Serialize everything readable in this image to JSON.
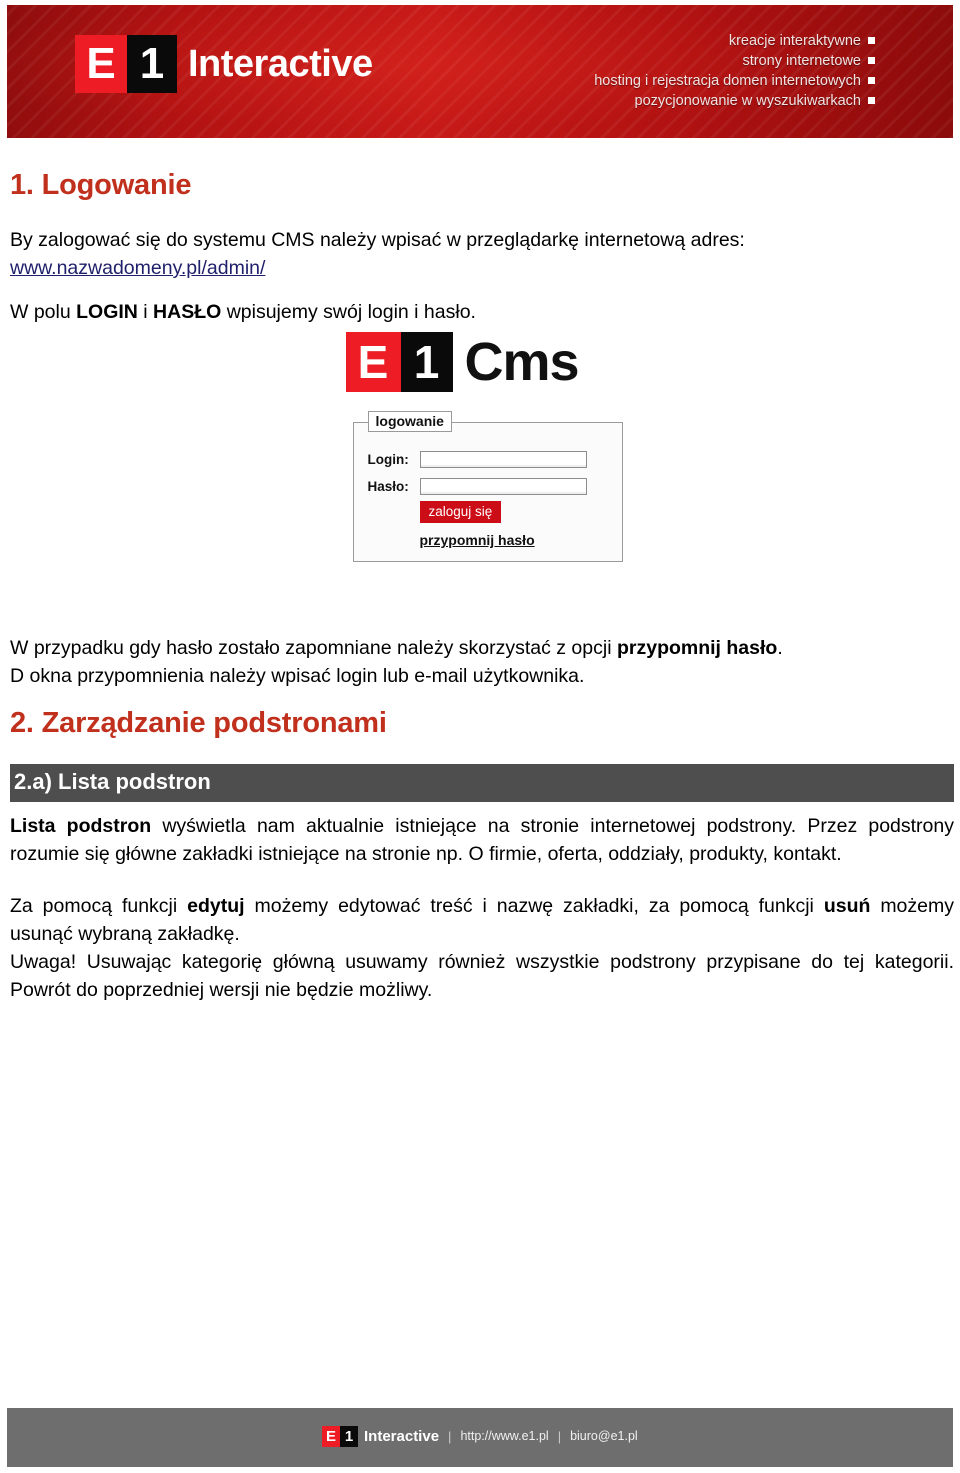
{
  "colors": {
    "brand_red": "#ee1c25",
    "header_red": "#b21212",
    "heading_red": "#c0301c",
    "link_navy": "#1f1f6b",
    "grey_bar": "#4e4e4e",
    "footer_grey": "#6e6e6e",
    "cms_button_red": "#cc0c16"
  },
  "header": {
    "logo": {
      "mark_left": "E",
      "mark_right": "1",
      "wordmark": "Interactive"
    },
    "taglines": [
      "kreacje interaktywne",
      "strony internetowe",
      "hosting i rejestracja domen internetowych",
      "pozycjonowanie w wyszukiwarkach"
    ]
  },
  "content": {
    "section1_title": "1. Logowanie",
    "p1_before_link": "By zalogować się do systemu CMS należy wpisać w przeglądarkę internetową adres:",
    "p1_link": "www.nazwadomeny.pl/admin/",
    "p2_prefix": "W polu ",
    "p2_bold1": "LOGIN",
    "p2_mid": " i ",
    "p2_bold2": "HASŁO",
    "p2_suffix": " wpisujemy swój login i hasło.",
    "p3_part1": "W przypadku gdy hasło zostało zapomniane należy skorzystać z opcji ",
    "p3_bold": "przypomnij hasło",
    "p3_part2": ".",
    "p3_line2": "D okna przypomnienia należy wpisać login lub e-mail użytkownika.",
    "section2_title": "2. Zarządzanie podstronami",
    "subsection_2a_title": "2.a) Lista podstron",
    "p4_bold": "Lista podstron",
    "p4_rest": " wyświetla nam aktualnie istniejące na stronie internetowej podstrony. Przez podstrony rozumie się główne zakładki istniejące na stronie np. O firmie, oferta, oddziały, produkty, kontakt.",
    "p5_part1": "Za pomocą funkcji ",
    "p5_bold1": "edytuj",
    "p5_part2": " możemy edytować treść i nazwę zakładki, za pomocą funkcji ",
    "p5_bold2": "usuń",
    "p5_part3": " możemy usunąć wybraną zakładkę.",
    "p6": "Uwaga! Usuwając kategorię główną usuwamy również wszystkie podstrony przypisane do tej kategorii. Powrót do poprzedniej wersji nie będzie możliwy."
  },
  "cms_screenshot": {
    "logo_mark_left": "E",
    "logo_mark_right": "1",
    "logo_word": "Cms",
    "legend": "logowanie",
    "login_label": "Login:",
    "login_value": "",
    "password_label": "Hasło:",
    "password_value": "",
    "submit_label": "zaloguj się",
    "remind_link": "przypomnij hasło"
  },
  "footer": {
    "logo_mark_left": "E",
    "logo_mark_right": "1",
    "wordmark": "Interactive",
    "separator": "|",
    "website": "http://www.e1.pl",
    "email": "biuro@e1.pl"
  }
}
